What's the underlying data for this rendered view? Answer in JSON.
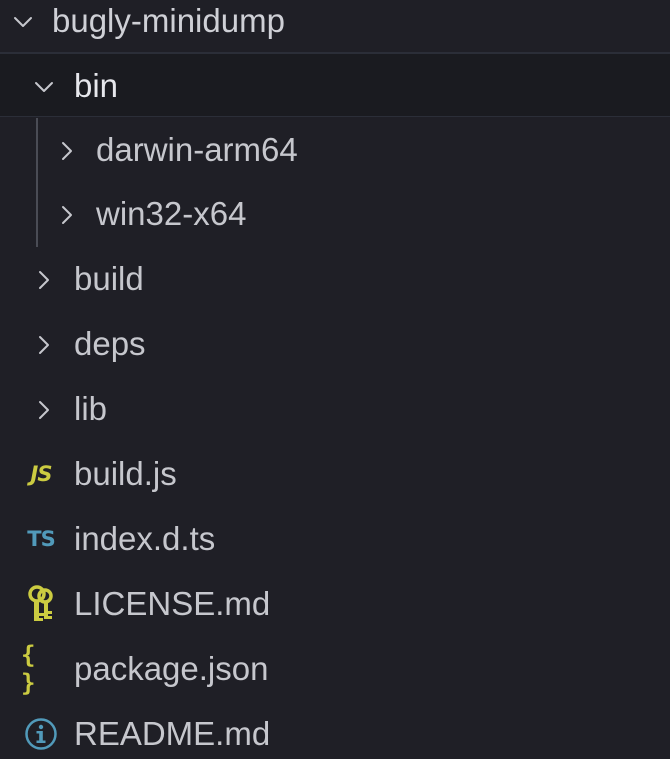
{
  "explorer": {
    "root": {
      "label": "bugly-minidump",
      "expanded": true
    },
    "items": [
      {
        "label": "bin",
        "type": "folder",
        "expanded": true,
        "selected": true
      },
      {
        "label": "darwin-arm64",
        "type": "folder",
        "expanded": false
      },
      {
        "label": "win32-x64",
        "type": "folder",
        "expanded": false
      },
      {
        "label": "build",
        "type": "folder",
        "expanded": false
      },
      {
        "label": "deps",
        "type": "folder",
        "expanded": false
      },
      {
        "label": "lib",
        "type": "folder",
        "expanded": false
      },
      {
        "label": "build.js",
        "type": "file",
        "icon": "javascript-icon",
        "icon_text": "JS"
      },
      {
        "label": "index.d.ts",
        "type": "file",
        "icon": "typescript-icon",
        "icon_text": "TS"
      },
      {
        "label": "LICENSE.md",
        "type": "file",
        "icon": "license-key-icon"
      },
      {
        "label": "package.json",
        "type": "file",
        "icon": "json-braces-icon",
        "icon_text": "{ }"
      },
      {
        "label": "README.md",
        "type": "file",
        "icon": "info-circle-icon"
      }
    ]
  },
  "colors": {
    "background": "#1f1f26",
    "js": "#cbcb41",
    "ts": "#519aba",
    "license": "#cbcb41",
    "readme": "#519aba"
  }
}
